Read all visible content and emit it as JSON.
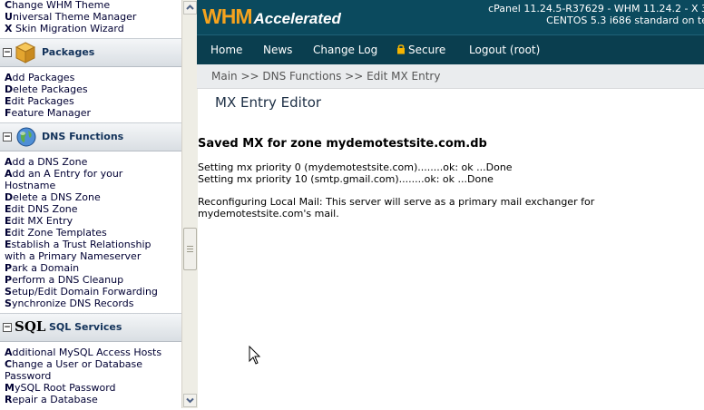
{
  "sidebar": {
    "top_links": [
      {
        "first": "C",
        "rest": "hange WHM Theme"
      },
      {
        "first": "U",
        "rest": "niversal Theme Manager"
      },
      {
        "first": "X",
        "rest": " Skin Migration Wizard"
      }
    ],
    "sections": [
      {
        "title": "Packages",
        "icon": "package-icon",
        "links": [
          {
            "first": "A",
            "rest": "dd Packages"
          },
          {
            "first": "D",
            "rest": "elete Packages"
          },
          {
            "first": "E",
            "rest": "dit Packages"
          },
          {
            "first": "F",
            "rest": "eature Manager"
          }
        ]
      },
      {
        "title": "DNS Functions",
        "icon": "globe-icon",
        "links": [
          {
            "first": "A",
            "rest": "dd a DNS Zone"
          },
          {
            "first": "A",
            "rest": "dd an A Entry for your"
          },
          {
            "first": "",
            "rest": "Hostname"
          },
          {
            "first": "D",
            "rest": "elete a DNS Zone"
          },
          {
            "first": "E",
            "rest": "dit DNS Zone"
          },
          {
            "first": "E",
            "rest": "dit MX Entry"
          },
          {
            "first": "E",
            "rest": "dit Zone Templates"
          },
          {
            "first": "E",
            "rest": "stablish a Trust Relationship"
          },
          {
            "first": "",
            "rest": "with a Primary Nameserver"
          },
          {
            "first": "P",
            "rest": "ark a Domain"
          },
          {
            "first": "P",
            "rest": "erform a DNS Cleanup"
          },
          {
            "first": "S",
            "rest": "etup/Edit Domain Forwarding"
          },
          {
            "first": "S",
            "rest": "ynchronize DNS Records"
          }
        ]
      },
      {
        "title": "SQL Services",
        "icon_text": "SQL",
        "links": [
          {
            "first": "A",
            "rest": "dditional MySQL Access Hosts"
          },
          {
            "first": "C",
            "rest": "hange a User or Database"
          },
          {
            "first": "",
            "rest": "Password"
          },
          {
            "first": "M",
            "rest": "ySQL Root Password"
          },
          {
            "first": "R",
            "rest": "epair a Database"
          }
        ]
      }
    ],
    "toggle_symbol": "−"
  },
  "header": {
    "logo_whm": "WHM",
    "logo_accelerated": "Accelerated",
    "server_line1": "cPanel 11.24.5-R37629 - WHM 11.24.2 - X 3",
    "server_line2": "CENTOS 5.3 i686 standard on te"
  },
  "nav": {
    "home": "Home",
    "news": "News",
    "changelog": "Change Log",
    "secure": "Secure",
    "logout": "Logout (root)"
  },
  "breadcrumb": "Main >> DNS Functions >> Edit MX Entry",
  "page_title": "MX Entry Editor",
  "result": {
    "heading": "Saved MX for zone mydemotestsite.com.db",
    "lines": [
      "Setting mx priority 0 (mydemotestsite.com)........ok: ok ...Done",
      "Setting mx priority 10 (smtp.gmail.com)........ok: ok ...Done"
    ],
    "reconfig_line1": "Reconfiguring Local Mail: This server will serve as a primary mail exchanger for",
    "reconfig_line2": "mydemotestsite.com's mail."
  },
  "colors": {
    "header_bg": "#0b4a5e",
    "nav_bg": "#0a3e4f",
    "logo_orange": "#f5a31e",
    "breadcrumb_bg": "#eaecee"
  }
}
